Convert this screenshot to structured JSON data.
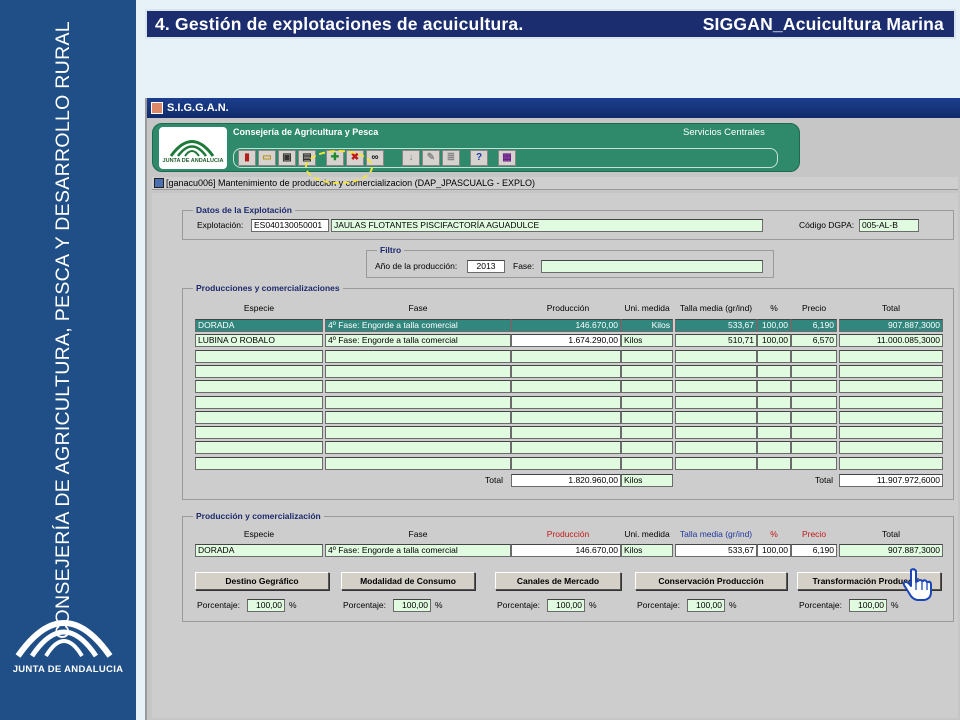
{
  "slide": {
    "title_left": "4. Gestión de explotaciones de acuicultura.",
    "title_right": "SIGGAN_Acuicultura Marina",
    "side_text": "CONSEJERÍA DE AGRICULTURA, PESCA Y DESARROLLO RURAL",
    "logo_text": "JUNTA DE ANDALUCIA"
  },
  "app": {
    "window_title": "S.I.G.G.A.N.",
    "header_title": "Consejería de Agricultura y Pesca",
    "header_right": "Servicios Centrales",
    "logo_small_text": "JUNTA DE ANDALUCIA",
    "form_title": "[ganacu006] Mantenimiento de produccion y comercializacion  (DAP_JPASCUALG - EXPLO)",
    "toolbar_icons": [
      "exit-icon",
      "open-folder-icon",
      "save-icon",
      "print-icon",
      "add-icon",
      "delete-icon",
      "search-binoculars-icon",
      "down-arrow-icon",
      "edit-icon",
      "list-icon",
      "help-icon",
      "tree-icon"
    ]
  },
  "datos": {
    "legend": "Datos de la Explotación",
    "explotacion_label": "Explotación:",
    "explotacion_code": "ES040130050001",
    "explotacion_name": "JAULAS FLOTANTES PISCIFACTORÍA AGUADULCE",
    "dgpa_label": "Código DGPA:",
    "dgpa_value": "005-AL-B"
  },
  "filtro": {
    "legend": "Filtro",
    "anio_label": "Año de la producción:",
    "anio_value": "2013",
    "fase_label": "Fase:",
    "fase_value": ""
  },
  "producciones": {
    "legend": "Producciones y comercializaciones",
    "headers": [
      "Especie",
      "Fase",
      "Producción",
      "Uni. medida",
      "Talla media (gr/ind)",
      "%",
      "Precio",
      "Total"
    ],
    "rows": [
      [
        "DORADA",
        "4º Fase: Engorde a talla comercial",
        "146.670,00",
        "Kilos",
        "533,67",
        "100,00",
        "6,190",
        "907.887,3000"
      ],
      [
        "LUBINA O ROBALO",
        "4º Fase: Engorde a talla comercial",
        "1.674.290,00",
        "Kilos",
        "510,71",
        "100,00",
        "6,570",
        "11.000.085,3000"
      ]
    ],
    "total_label": "Total",
    "total_produccion": "1.820.960,00",
    "total_unidad": "Kilos",
    "total_label2": "Total",
    "total_importe": "11.907.972,6000"
  },
  "detalle": {
    "legend": "Producción y comercialización",
    "headers": [
      "Especie",
      "Fase",
      "Producción",
      "Uni. medida",
      "Talla media (gr/ind)",
      "%",
      "Precio",
      "Total"
    ],
    "row": [
      "DORADA",
      "4º Fase: Engorde a talla comercial",
      "146.670,00",
      "Kilos",
      "533,67",
      "100,00",
      "6,190",
      "907.887,3000"
    ],
    "buttons": [
      "Destino Gegráfico",
      "Modalidad de Consumo",
      "Canales de Mercado",
      "Conservación Producción",
      "Transformación Producción"
    ],
    "porcentaje_label": "Porcentaje:",
    "porcentaje_value": "100,00",
    "percent_sign": "%"
  }
}
